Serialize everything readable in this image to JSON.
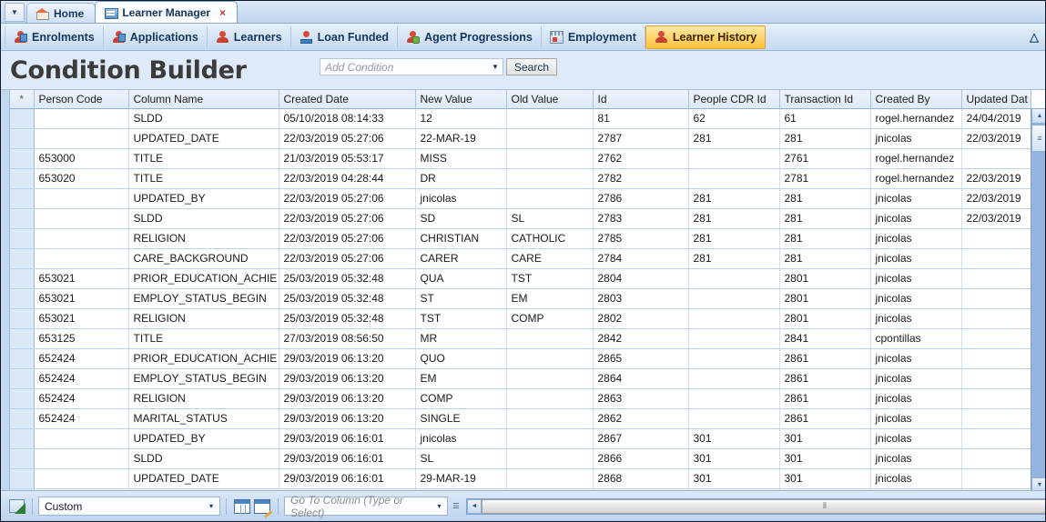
{
  "window": {
    "tab_dropdown_icon": "chevron-down-icon",
    "tabs": [
      {
        "label": "Home",
        "icon": "home-icon",
        "active": false,
        "closable": false
      },
      {
        "label": "Learner Manager",
        "icon": "grid-window-icon",
        "active": true,
        "closable": true,
        "close_glyph": "×"
      }
    ]
  },
  "ribbon": {
    "items": [
      {
        "label": "Enrolments",
        "icon": "enrolments-person-icon",
        "selected": false
      },
      {
        "label": "Applications",
        "icon": "applications-person-icon",
        "selected": false
      },
      {
        "label": "Learners",
        "icon": "learners-person-icon",
        "selected": false
      },
      {
        "label": "Loan Funded",
        "icon": "loan-funded-icon",
        "selected": false
      },
      {
        "label": "Agent Progressions",
        "icon": "agent-progressions-icon",
        "selected": false
      },
      {
        "label": "Employment",
        "icon": "employment-icon",
        "selected": false
      },
      {
        "label": "Learner History",
        "icon": "learner-history-person-icon",
        "selected": true
      }
    ],
    "collapse_icon": "chevron-up-double-icon"
  },
  "header": {
    "title": "Condition Builder",
    "condition_combo": {
      "placeholder": "Add Condition",
      "value": "",
      "arrow_glyph": "▼"
    },
    "search_button": "Search"
  },
  "grid": {
    "columns": [
      {
        "key": "star",
        "label": "*"
      },
      {
        "key": "person",
        "label": "Person Code"
      },
      {
        "key": "column",
        "label": "Column Name"
      },
      {
        "key": "created",
        "label": "Created Date"
      },
      {
        "key": "newval",
        "label": "New Value"
      },
      {
        "key": "oldval",
        "label": "Old Value"
      },
      {
        "key": "id",
        "label": "Id"
      },
      {
        "key": "cdr",
        "label": "People CDR Id"
      },
      {
        "key": "trans",
        "label": "Transaction Id"
      },
      {
        "key": "by",
        "label": "Created By"
      },
      {
        "key": "upd",
        "label": "Updated Dat"
      }
    ],
    "rows": [
      {
        "person": "",
        "column": "SLDD",
        "created": "05/10/2018 08:14:33",
        "newval": "12",
        "oldval": "",
        "id": "81",
        "cdr": "62",
        "trans": "61",
        "by": "rogel.hernandez",
        "upd": "24/04/2019"
      },
      {
        "person": "",
        "column": "UPDATED_DATE",
        "created": "22/03/2019 05:27:06",
        "newval": "22-MAR-19",
        "oldval": "",
        "id": "2787",
        "cdr": "281",
        "trans": "281",
        "by": "jnicolas",
        "upd": "22/03/2019"
      },
      {
        "person": "653000",
        "column": "TITLE",
        "created": "21/03/2019 05:53:17",
        "newval": "MISS",
        "oldval": "",
        "id": "2762",
        "cdr": "",
        "trans": "2761",
        "by": "rogel.hernandez",
        "upd": ""
      },
      {
        "person": "653020",
        "column": "TITLE",
        "created": "22/03/2019 04:28:44",
        "newval": "DR",
        "oldval": "",
        "id": "2782",
        "cdr": "",
        "trans": "2781",
        "by": "rogel.hernandez",
        "upd": "22/03/2019"
      },
      {
        "person": "",
        "column": "UPDATED_BY",
        "created": "22/03/2019 05:27:06",
        "newval": "jnicolas",
        "oldval": "",
        "id": "2786",
        "cdr": "281",
        "trans": "281",
        "by": "jnicolas",
        "upd": "22/03/2019"
      },
      {
        "person": "",
        "column": "SLDD",
        "created": "22/03/2019 05:27:06",
        "newval": "SD",
        "oldval": "SL",
        "id": "2783",
        "cdr": "281",
        "trans": "281",
        "by": "jnicolas",
        "upd": "22/03/2019"
      },
      {
        "person": "",
        "column": "RELIGION",
        "created": "22/03/2019 05:27:06",
        "newval": "CHRISTIAN",
        "oldval": "CATHOLIC",
        "id": "2785",
        "cdr": "281",
        "trans": "281",
        "by": "jnicolas",
        "upd": ""
      },
      {
        "person": "",
        "column": "CARE_BACKGROUND",
        "created": "22/03/2019 05:27:06",
        "newval": "CARER",
        "oldval": "CARE",
        "id": "2784",
        "cdr": "281",
        "trans": "281",
        "by": "jnicolas",
        "upd": ""
      },
      {
        "person": "653021",
        "column": "PRIOR_EDUCATION_ACHIE…",
        "created": "25/03/2019 05:32:48",
        "newval": "QUA",
        "oldval": "TST",
        "id": "2804",
        "cdr": "",
        "trans": "2801",
        "by": "jnicolas",
        "upd": ""
      },
      {
        "person": "653021",
        "column": "EMPLOY_STATUS_BEGIN",
        "created": "25/03/2019 05:32:48",
        "newval": "ST",
        "oldval": "EM",
        "id": "2803",
        "cdr": "",
        "trans": "2801",
        "by": "jnicolas",
        "upd": ""
      },
      {
        "person": "653021",
        "column": "RELIGION",
        "created": "25/03/2019 05:32:48",
        "newval": "TST",
        "oldval": "COMP",
        "id": "2802",
        "cdr": "",
        "trans": "2801",
        "by": "jnicolas",
        "upd": ""
      },
      {
        "person": "653125",
        "column": "TITLE",
        "created": "27/03/2019 08:56:50",
        "newval": "MR",
        "oldval": "",
        "id": "2842",
        "cdr": "",
        "trans": "2841",
        "by": "cpontillas",
        "upd": ""
      },
      {
        "person": "652424",
        "column": "PRIOR_EDUCATION_ACHIE…",
        "created": "29/03/2019 06:13:20",
        "newval": "QUO",
        "oldval": "",
        "id": "2865",
        "cdr": "",
        "trans": "2861",
        "by": "jnicolas",
        "upd": ""
      },
      {
        "person": "652424",
        "column": "EMPLOY_STATUS_BEGIN",
        "created": "29/03/2019 06:13:20",
        "newval": "EM",
        "oldval": "",
        "id": "2864",
        "cdr": "",
        "trans": "2861",
        "by": "jnicolas",
        "upd": ""
      },
      {
        "person": "652424",
        "column": "RELIGION",
        "created": "29/03/2019 06:13:20",
        "newval": "COMP",
        "oldval": "",
        "id": "2863",
        "cdr": "",
        "trans": "2861",
        "by": "jnicolas",
        "upd": ""
      },
      {
        "person": "652424",
        "column": "MARITAL_STATUS",
        "created": "29/03/2019 06:13:20",
        "newval": "SINGLE",
        "oldval": "",
        "id": "2862",
        "cdr": "",
        "trans": "2861",
        "by": "jnicolas",
        "upd": ""
      },
      {
        "person": "",
        "column": "UPDATED_BY",
        "created": "29/03/2019 06:16:01",
        "newval": "jnicolas",
        "oldval": "",
        "id": "2867",
        "cdr": "301",
        "trans": "301",
        "by": "jnicolas",
        "upd": ""
      },
      {
        "person": "",
        "column": "SLDD",
        "created": "29/03/2019 06:16:01",
        "newval": "SL",
        "oldval": "",
        "id": "2866",
        "cdr": "301",
        "trans": "301",
        "by": "jnicolas",
        "upd": ""
      },
      {
        "person": "",
        "column": "UPDATED_DATE",
        "created": "29/03/2019 06:16:01",
        "newval": "29-MAR-19",
        "oldval": "",
        "id": "2868",
        "cdr": "301",
        "trans": "301",
        "by": "jnicolas",
        "upd": ""
      },
      {
        "person": "",
        "column": "",
        "created": "",
        "newval": "",
        "oldval": "",
        "id": "",
        "cdr": "",
        "trans": "",
        "by": "",
        "upd": ""
      }
    ],
    "vscroll": {
      "up_glyph": "▲",
      "down_glyph": "▼",
      "thumb_glyph": "≡"
    }
  },
  "statusbar": {
    "export_icon": "export-to-excel-icon",
    "layout_combo": {
      "value": "Custom",
      "arrow_glyph": "▾"
    },
    "grid_view_icon": "grid-layout-icon",
    "grid_edit_icon": "grid-edit-icon",
    "goto_combo": {
      "placeholder": "Go To Column (Type or Select)",
      "value": "",
      "arrow_glyph": "▾"
    },
    "resize_glyph": "☰",
    "hscroll": {
      "left_glyph": "◄",
      "right_glyph": "►",
      "thumb_glyph": "⦀"
    }
  }
}
